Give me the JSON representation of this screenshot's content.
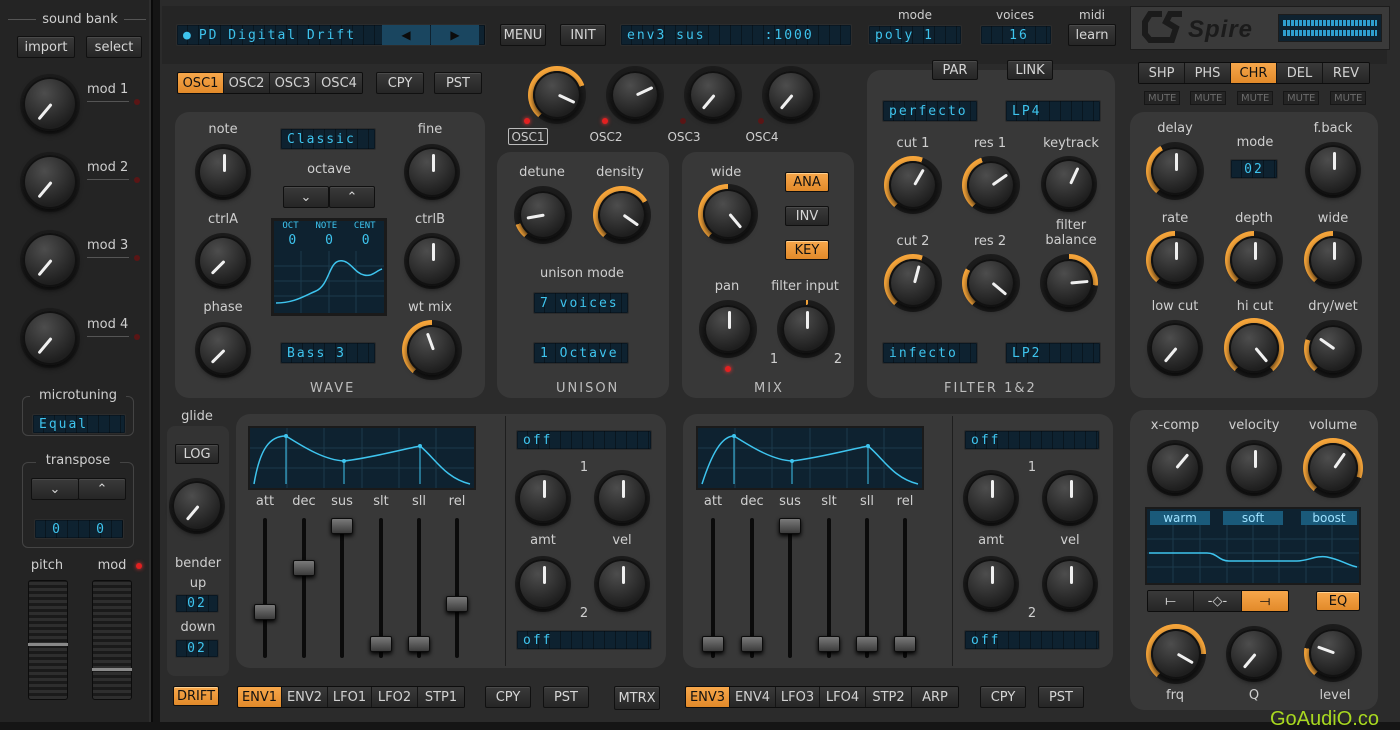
{
  "sidebar": {
    "sound_bank": "sound bank",
    "import": "import",
    "select": "select",
    "mods": [
      "mod 1",
      "mod 2",
      "mod 3",
      "mod 4"
    ],
    "microtuning": "microtuning",
    "microtuning_value": "Equal",
    "transpose": "transpose",
    "transpose_values": [
      "0",
      "0"
    ],
    "pitch": "pitch",
    "mod": "mod"
  },
  "header": {
    "preset": "PD Digital Drift",
    "menu": "MENU",
    "init": "INIT",
    "param_display": "env3 sus      :1000",
    "mode_label": "mode",
    "mode_value": "poly 1",
    "voices_label": "voices",
    "voices_value": "16",
    "midi_label": "midi",
    "midi_learn": "learn",
    "logo": "Spire"
  },
  "osc": {
    "tabs": [
      "OSC1",
      "OSC2",
      "OSC3",
      "OSC4"
    ],
    "active": "OSC1",
    "cpy": "CPY",
    "pst": "PST",
    "wave_type": "Classic",
    "wave_name": "Bass 3",
    "labels": {
      "note": "note",
      "fine": "fine",
      "octave": "octave",
      "ctrlA": "ctrlA",
      "ctrlB": "ctrlB",
      "phase": "phase",
      "wt_mix": "wt mix"
    },
    "readout_heads": [
      "OCT",
      "NOTE",
      "CENT"
    ],
    "readout_vals": [
      "0",
      "0",
      "0"
    ],
    "section": "WAVE",
    "osc_levels": [
      "OSC1",
      "OSC2",
      "OSC3",
      "OSC4"
    ]
  },
  "unison": {
    "detune": "detune",
    "density": "density",
    "mode_label": "unison mode",
    "voices": "7 voices",
    "octave": "1 Octave",
    "section": "UNISON"
  },
  "mix": {
    "wide": "wide",
    "ana": "ANA",
    "inv": "INV",
    "key": "KEY",
    "pan": "pan",
    "filter_input": "filter input",
    "one": "1",
    "two": "2",
    "section": "MIX"
  },
  "filter": {
    "par": "PAR",
    "link": "LINK",
    "type1": "perfecto",
    "mode1": "LP4",
    "type2": "infecto",
    "mode2": "LP2",
    "labels": [
      "cut 1",
      "res 1",
      "keytrack",
      "cut 2",
      "res 2"
    ],
    "balance": "filter",
    "balance2": "balance",
    "section": "FILTER 1&2"
  },
  "fx": {
    "tabs": [
      "SHP",
      "PHS",
      "CHR",
      "DEL",
      "REV"
    ],
    "active": "CHR",
    "mutes": [
      "MUTE",
      "MUTE",
      "MUTE",
      "MUTE",
      "MUTE"
    ],
    "labels": [
      "delay",
      "mode",
      "f.back",
      "rate",
      "depth",
      "wide",
      "low cut",
      "hi cut",
      "dry/wet"
    ],
    "mode_value": "02"
  },
  "master": {
    "labels": [
      "x-comp",
      "velocity",
      "volume"
    ],
    "eq_tabs": [
      "warm",
      "soft",
      "boost"
    ],
    "eq": "EQ",
    "eq_labels": [
      "frq",
      "Q",
      "level"
    ]
  },
  "glide": {
    "label": "glide",
    "log": "LOG",
    "bender": "bender",
    "up": "up",
    "up_val": "02",
    "down": "down",
    "down_val": "02",
    "drift": "DRIFT"
  },
  "env": {
    "labels": [
      "att",
      "dec",
      "sus",
      "slt",
      "sll",
      "rel"
    ],
    "off": "off",
    "amt": "amt",
    "vel": "vel",
    "one": "1",
    "two": "2"
  },
  "bottom": {
    "tabs_left": [
      "ENV1",
      "ENV2",
      "LFO1",
      "LFO2",
      "STP1"
    ],
    "tabs_right": [
      "ENV3",
      "ENV4",
      "LFO3",
      "LFO4",
      "STP2",
      "ARP"
    ],
    "cpy": "CPY",
    "pst": "PST",
    "mtrx": "MTRX"
  },
  "watermark": "GoAudiO.co"
}
